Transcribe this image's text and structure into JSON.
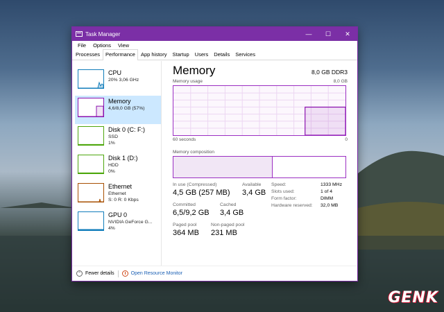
{
  "window": {
    "title": "Task Manager",
    "controls": {
      "minimize": "—",
      "maximize": "☐",
      "close": "✕"
    }
  },
  "menu": [
    "File",
    "Options",
    "View"
  ],
  "tabs": [
    {
      "label": "Processes"
    },
    {
      "label": "Performance",
      "active": true
    },
    {
      "label": "App history"
    },
    {
      "label": "Startup"
    },
    {
      "label": "Users"
    },
    {
      "label": "Details"
    },
    {
      "label": "Services"
    }
  ],
  "sidebar": {
    "items": [
      {
        "name": "CPU",
        "line1": "20% 3,06 GHz",
        "line2": "",
        "color": "#117dbb",
        "icon": "cpu-thumbnail",
        "fill": 0.2
      },
      {
        "name": "Memory",
        "line1": "4,6/8,0 GB (57%)",
        "line2": "",
        "color": "#8b12ae",
        "icon": "memory-thumbnail",
        "fill": 0.57,
        "selected": true
      },
      {
        "name": "Disk 0 (C: F:)",
        "line1": "SSD",
        "line2": "1%",
        "color": "#4da60c",
        "icon": "disk-thumbnail",
        "fill": 0.01
      },
      {
        "name": "Disk 1 (D:)",
        "line1": "HDD",
        "line2": "0%",
        "color": "#4da60c",
        "icon": "disk-thumbnail",
        "fill": 0
      },
      {
        "name": "Ethernet",
        "line1": "Ethernet",
        "line2": "S: 0 R: 0 Kbps",
        "color": "#a74f01",
        "icon": "ethernet-thumbnail",
        "fill": 0
      },
      {
        "name": "GPU 0",
        "line1": "NVIDIA GeForce G...",
        "line2": "4%",
        "color": "#117dbb",
        "icon": "gpu-thumbnail",
        "fill": 0.04
      }
    ]
  },
  "memory": {
    "title": "Memory",
    "spec": "8,0 GB DDR3",
    "usage_label": "Memory usage",
    "usage_max": "8,0 GB",
    "time_left": "60 seconds",
    "time_right": "0",
    "composition_label": "Memory composition",
    "in_use_fraction": 0.57,
    "accent_color": "#8b12ae",
    "stats": {
      "in_use_label": "In use (Compressed)",
      "in_use_value": "4,5 GB (257 MB)",
      "available_label": "Available",
      "available_value": "3,4 GB",
      "committed_label": "Committed",
      "committed_value": "6,5/9,2 GB",
      "cached_label": "Cached",
      "cached_value": "3,4 GB",
      "paged_label": "Paged pool",
      "paged_value": "364 MB",
      "nonpaged_label": "Non-paged pool",
      "nonpaged_value": "231 MB"
    },
    "details": [
      {
        "key": "Speed:",
        "value": "1333 MHz"
      },
      {
        "key": "Slots used:",
        "value": "1 of 4"
      },
      {
        "key": "Form factor:",
        "value": "DIMM"
      },
      {
        "key": "Hardware reserved:",
        "value": "32,0 MB"
      }
    ]
  },
  "footer": {
    "fewer_details": "Fewer details",
    "open_resource_monitor": "Open Resource Monitor"
  },
  "watermark": "GENK"
}
